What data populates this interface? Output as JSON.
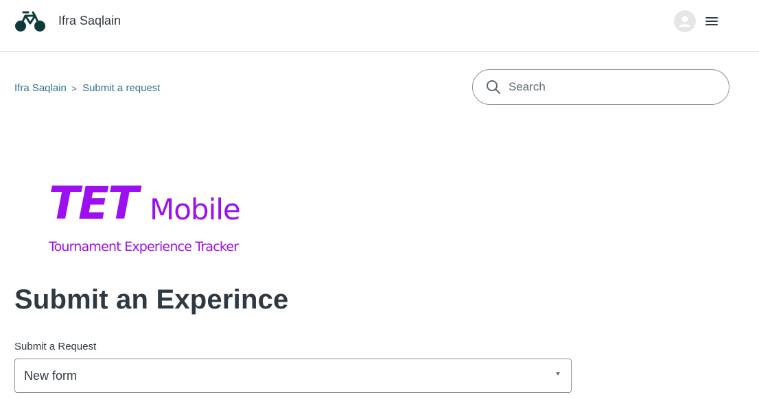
{
  "header": {
    "brand_name": "Ifra Saqlain",
    "logo_icon": "bicycle-logo-icon",
    "avatar_icon": "user-avatar-icon",
    "menu_icon": "hamburger-menu-icon",
    "colors": {
      "logo": "#0f3a3a",
      "border": "#dcdcdc"
    }
  },
  "breadcrumbs": {
    "items": [
      {
        "label": "Ifra Saqlain"
      },
      {
        "label": "Submit a request"
      }
    ],
    "separator": ">"
  },
  "search": {
    "placeholder": "Search",
    "icon": "search-icon"
  },
  "banner": {
    "logo_text_main": "TET",
    "logo_text_sub": "Mobile",
    "logo_tagline": "Tournament Experience Tracker",
    "accent_color": "#9b0ff0"
  },
  "main": {
    "title": "Submit an Experince",
    "form_label": "Submit a Request",
    "form_select_value": "New form"
  }
}
